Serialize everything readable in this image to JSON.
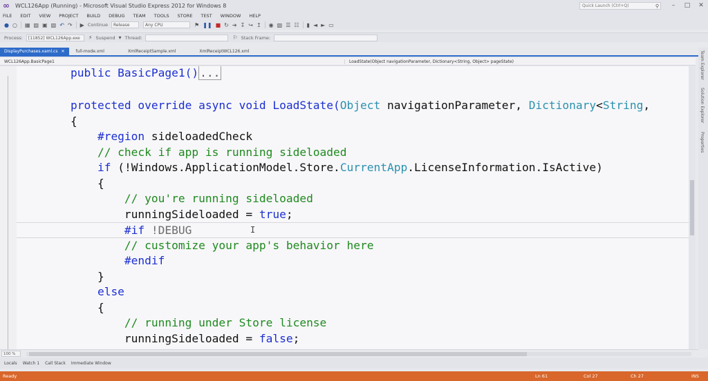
{
  "window": {
    "title": "WCL126App (Running) - Microsoft Visual Studio Express 2012 for Windows 8",
    "quick_launch_placeholder": "Quick Launch (Ctrl+Q)",
    "minimize": "–",
    "restore": "□",
    "close": "✕"
  },
  "menu": [
    "FILE",
    "EDIT",
    "VIEW",
    "PROJECT",
    "BUILD",
    "DEBUG",
    "TEAM",
    "TOOLS",
    "STORE",
    "TEST",
    "WINDOW",
    "HELP"
  ],
  "toolbar": {
    "continue_label": "Continue",
    "config": "Release",
    "platform": "Any CPU",
    "process_label": "Process:",
    "process_value": "[11852] WCL126App.exe",
    "suspend_label": "Suspend",
    "thread_label": "Thread:",
    "stack_frame_label": "Stack Frame:"
  },
  "tabs": [
    {
      "label": "DisplayPurchases.xaml.cs",
      "active": true,
      "pin": "✕"
    },
    {
      "label": "full-mode.xml",
      "active": false
    },
    {
      "label": "XmlReceiptSample.xml",
      "active": false
    },
    {
      "label": "XmlReceiptWCL126.xml",
      "active": false
    }
  ],
  "navbar": {
    "left": "WCL126App.BasicPage1",
    "right": "LoadState(Object navigationParameter, Dictionary<String, Object> pageState)"
  },
  "code": {
    "l1a": "        public BasicPage1()",
    "l1b": "...",
    "l2a": "        protected override async void LoadState(",
    "l2b": "Object",
    "l2c": " navigationParameter, ",
    "l2d": "Dictionary",
    "l2e": "<",
    "l2f": "String",
    "l2g": ",",
    "l3": "        {",
    "l4a": "            #region",
    "l4b": " sideloadedCheck",
    "l5": "            // check if app is running sideloaded",
    "l6a": "            if",
    "l6b": " (!Windows.ApplicationModel.Store.",
    "l6c": "CurrentApp",
    "l6d": ".LicenseInformation.IsActive)",
    "l7": "            {",
    "l8": "                // you're running sideloaded",
    "l9a": "                runningSideloaded = ",
    "l9b": "true",
    "l9c": ";",
    "l10a": "                #if",
    "l10b": " !DEBUG",
    "l11": "                // customize your app's behavior here",
    "l12": "                #endif",
    "l13": "            }",
    "l14": "            else",
    "l15": "            {",
    "l16": "                // running under Store license",
    "l17a": "                runningSideloaded = ",
    "l17b": "false",
    "l17c": ";"
  },
  "side_tabs": [
    "Team Explorer",
    "Solution Explorer",
    "Properties"
  ],
  "zoom": "100 %",
  "panel_tabs": [
    "Locals",
    "Watch 1",
    "Call Stack",
    "Immediate Window"
  ],
  "status": {
    "ready": "Ready",
    "ln": "Ln 61",
    "col": "Col 27",
    "ch": "Ch 27",
    "ins": "INS"
  },
  "colors": {
    "keyword": "#1c2fd1",
    "type": "#2b91af",
    "comment": "#1f8a1f",
    "status_bar": "#d9662a",
    "active_tab": "#2d6bc9"
  }
}
